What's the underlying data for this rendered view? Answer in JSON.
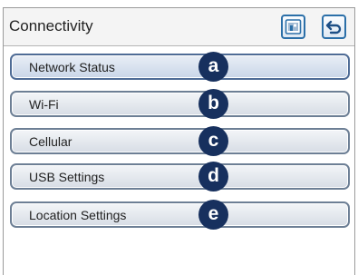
{
  "header": {
    "title": "Connectivity",
    "home_icon": "home-dashboard-icon",
    "back_icon": "back-arrow-icon",
    "accent_color": "#2b6fa8"
  },
  "menu": {
    "items": [
      {
        "label": "Network Status",
        "badge": "a"
      },
      {
        "label": "Wi-Fi",
        "badge": "b"
      },
      {
        "label": "Cellular",
        "badge": "c"
      },
      {
        "label": "USB Settings",
        "badge": "d"
      },
      {
        "label": "Location Settings",
        "badge": "e"
      }
    ],
    "badge_color": "#17305e"
  }
}
